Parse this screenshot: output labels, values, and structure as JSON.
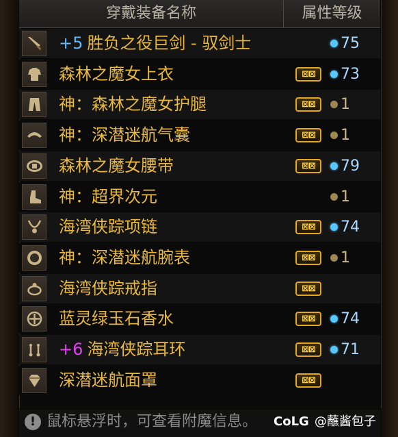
{
  "header": {
    "name_col": "穿戴装备名称",
    "attr_col": "属性等级"
  },
  "items": [
    {
      "icon": "sword-icon",
      "enhance": "+5",
      "enhance_color": "blue",
      "name": "胜负之役巨剑 - 驭剑士",
      "cube": false,
      "dot": "blue",
      "level": "75"
    },
    {
      "icon": "top-armor-icon",
      "enhance": "",
      "enhance_color": "",
      "name": "森林之魔女上衣",
      "cube": true,
      "dot": "blue",
      "level": "73"
    },
    {
      "icon": "pants-icon",
      "enhance": "",
      "enhance_color": "",
      "name": "神：森林之魔女护腿",
      "cube": true,
      "dot": "gold",
      "level": "1"
    },
    {
      "icon": "shoulder-icon",
      "enhance": "",
      "enhance_color": "",
      "name": "神：深潜迷航气囊",
      "cube": true,
      "dot": "gold",
      "level": "1"
    },
    {
      "icon": "belt-icon",
      "enhance": "",
      "enhance_color": "",
      "name": "森林之魔女腰带",
      "cube": true,
      "dot": "blue",
      "level": "79"
    },
    {
      "icon": "shoes-icon",
      "enhance": "",
      "enhance_color": "",
      "name": "神：超界次元",
      "cube": false,
      "dot": "gold",
      "level": "1"
    },
    {
      "icon": "necklace-icon",
      "enhance": "",
      "enhance_color": "",
      "name": "海湾侠踪项链",
      "cube": true,
      "dot": "blue",
      "level": "74"
    },
    {
      "icon": "bracelet-icon",
      "enhance": "",
      "enhance_color": "",
      "name": "神：深潜迷航腕表",
      "cube": true,
      "dot": "gold",
      "level": "1"
    },
    {
      "icon": "ring-icon",
      "enhance": "",
      "enhance_color": "",
      "name": "海湾侠踪戒指",
      "cube": true,
      "dot": "",
      "level": ""
    },
    {
      "icon": "sub-equip-icon",
      "enhance": "",
      "enhance_color": "",
      "name": "蓝灵绿玉石香水",
      "cube": true,
      "dot": "blue",
      "level": "74"
    },
    {
      "icon": "earring-icon",
      "enhance": "+6",
      "enhance_color": "purple",
      "name": "海湾侠踪耳环",
      "cube": true,
      "dot": "blue",
      "level": "71"
    },
    {
      "icon": "magic-stone-icon",
      "enhance": "",
      "enhance_color": "",
      "name": "深潜迷航面罩",
      "cube": true,
      "dot": "",
      "level": ""
    }
  ],
  "cube_label": "⊠⊠",
  "footer": {
    "info_icon": "!",
    "tip": "鼠标悬浮时，可查看附魔信息。"
  },
  "watermark": {
    "brand": "CoLG",
    "user": "@蘸酱包子"
  },
  "colors": {
    "item_name": "#e8b83c",
    "enhance_blue": "#5fb8ff",
    "enhance_purple": "#e040f0",
    "dot_blue": "#58c6ff",
    "dot_gold": "#a08650"
  }
}
